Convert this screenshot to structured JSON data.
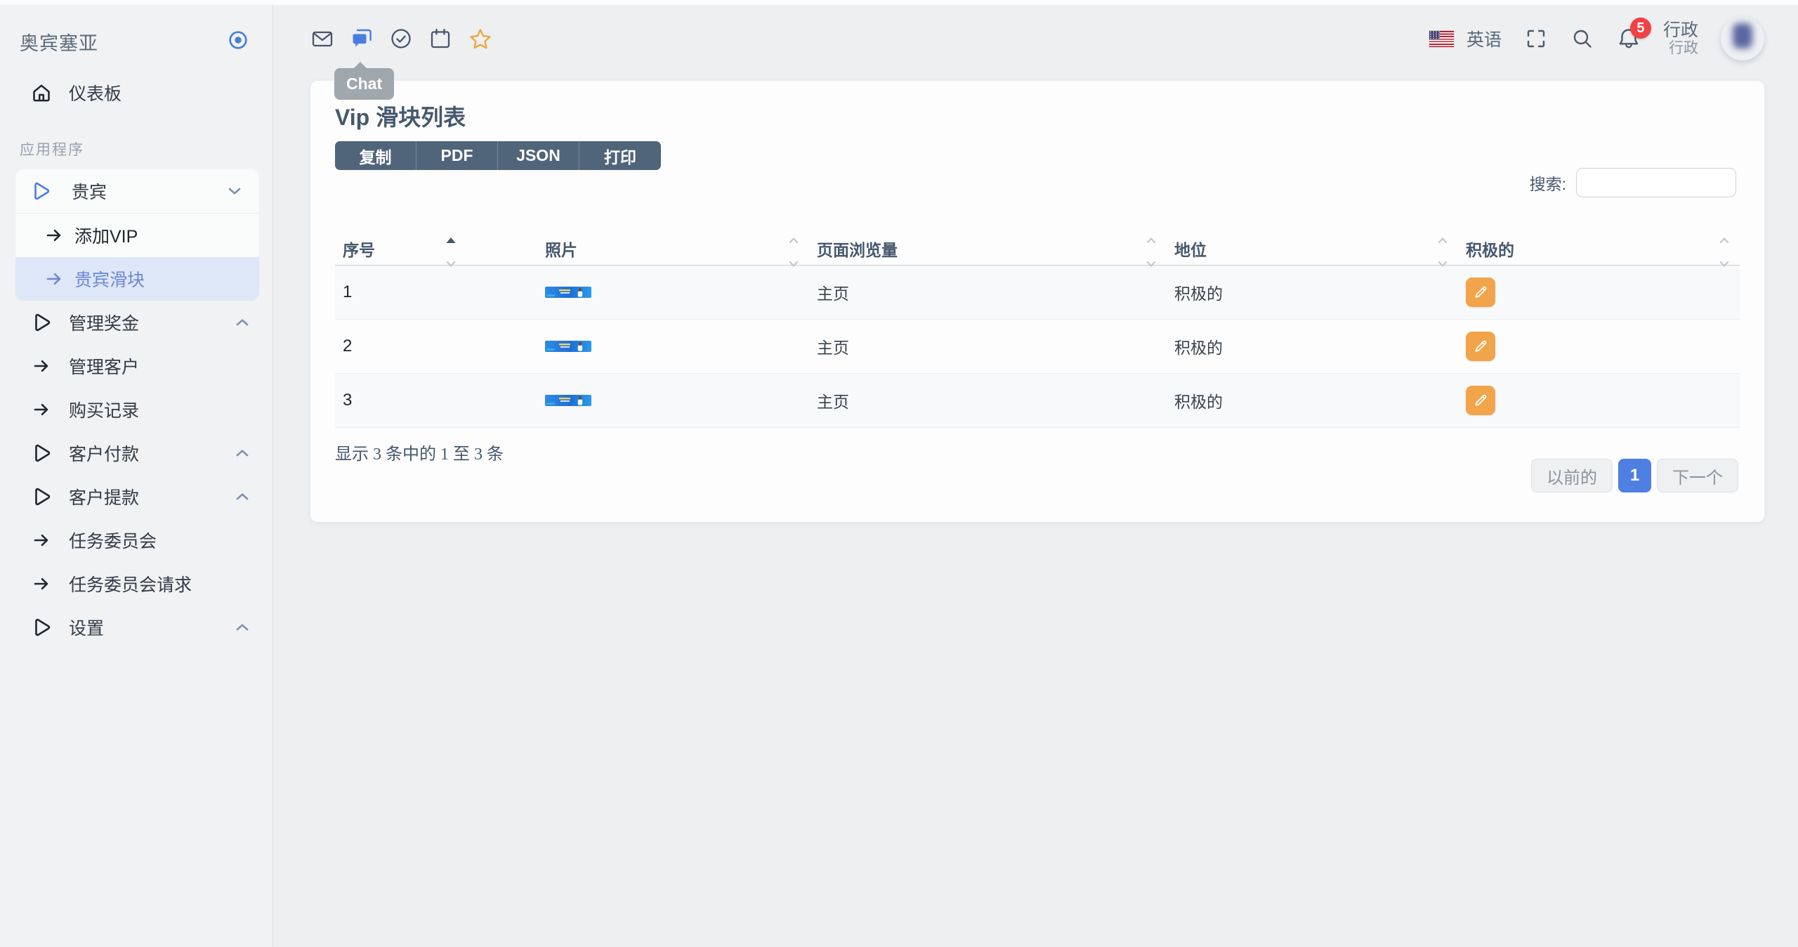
{
  "colors": {
    "accent_blue": "#4a7de0",
    "active_item_bg": "#dee7f8",
    "active_item_text": "#6d87d3",
    "export_button_bg": "#50647a",
    "edit_button_orange": "#f2a44a",
    "badge_red": "#f04144",
    "star_orange": "#f0a63e",
    "pagination_current_bg": "#4e7fe1"
  },
  "sidebar": {
    "brand": "奥宾塞亚",
    "dashboard": "仪表板",
    "section": "应用程序",
    "vip_group": {
      "label": "贵宾",
      "items": [
        {
          "label": "添加VIP"
        },
        {
          "label": "贵宾滑块"
        }
      ]
    },
    "items": [
      {
        "label": "管理奖金"
      },
      {
        "label": "管理客户"
      },
      {
        "label": "购买记录"
      },
      {
        "label": "客户付款"
      },
      {
        "label": "客户提款"
      },
      {
        "label": "任务委员会"
      },
      {
        "label": "任务委员会请求"
      },
      {
        "label": "设置"
      }
    ]
  },
  "topbar": {
    "tooltip": "Chat",
    "language": "英语",
    "badge_count": "5",
    "user_name": "行政",
    "user_role": "行政"
  },
  "page": {
    "title": "Vip 滑块列表",
    "export_buttons": [
      "复制",
      "PDF",
      "JSON",
      "打印"
    ],
    "search_label": "搜索:",
    "table": {
      "columns": [
        "序号",
        "照片",
        "页面浏览量",
        "地位",
        "积极的"
      ],
      "rows": [
        {
          "serial": "1",
          "page_view": "主页",
          "status": "积极的"
        },
        {
          "serial": "2",
          "page_view": "主页",
          "status": "积极的"
        },
        {
          "serial": "3",
          "page_view": "主页",
          "status": "积极的"
        }
      ]
    },
    "summary": "显示 3 条中的 1 至 3 条",
    "pagination": {
      "previous": "以前的",
      "current": "1",
      "next": "下一个"
    }
  }
}
